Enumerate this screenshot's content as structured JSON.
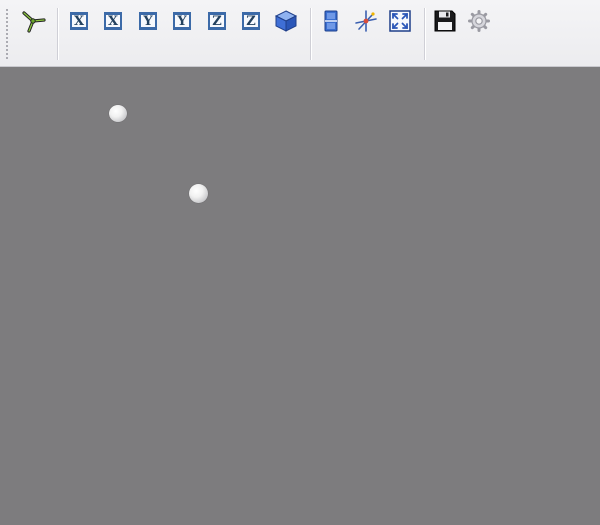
{
  "toolbar": {
    "groups": [
      {
        "name": "logo",
        "items": [
          {
            "icon": "trefoil-logo-icon"
          }
        ]
      },
      {
        "name": "view-orientation",
        "items": [
          {
            "icon": "view-x-positive-icon",
            "label": "X"
          },
          {
            "icon": "view-x-negative-icon",
            "label": "X"
          },
          {
            "icon": "view-y-positive-icon",
            "label": "Y"
          },
          {
            "icon": "view-y-negative-icon",
            "label": "Y"
          },
          {
            "icon": "view-z-positive-icon",
            "label": "Z"
          },
          {
            "icon": "view-z-negative-icon",
            "label": "Z"
          },
          {
            "icon": "isometric-cube-icon"
          }
        ]
      },
      {
        "name": "view-tools",
        "items": [
          {
            "icon": "split-layout-icon"
          },
          {
            "icon": "axes-star-icon"
          },
          {
            "icon": "fit-to-screen-icon"
          }
        ]
      },
      {
        "name": "file",
        "items": [
          {
            "icon": "save-floppy-icon"
          },
          {
            "icon": "settings-gear-icon"
          }
        ]
      }
    ]
  },
  "colors": {
    "toolbar_bg": "#efeff2",
    "viewport_bg": "#7d7c7e",
    "icon_blue": "#3c6aa8",
    "logo_green": "#7fbf2a"
  },
  "viewport": {
    "objects": [
      {
        "type": "sphere"
      },
      {
        "type": "sphere"
      }
    ]
  }
}
